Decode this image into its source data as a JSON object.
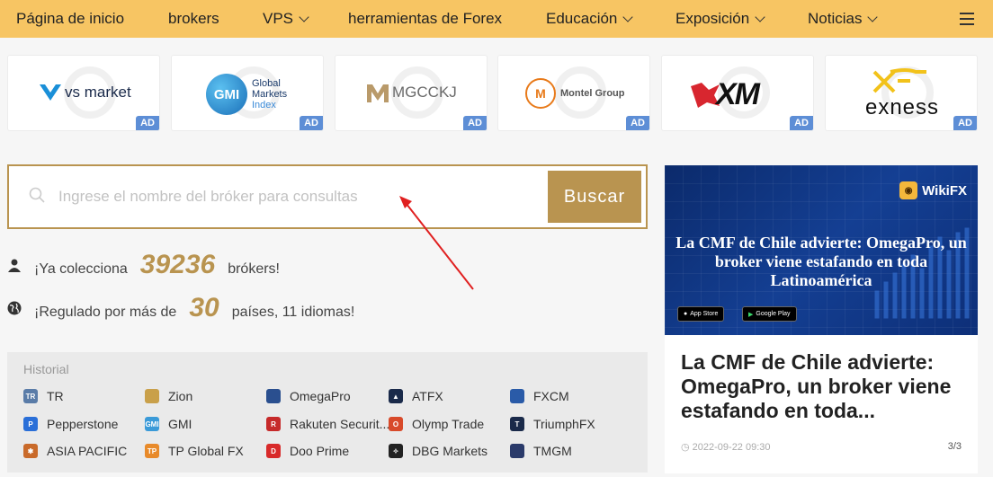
{
  "nav": {
    "items": [
      {
        "label": "Página de inicio",
        "dropdown": false
      },
      {
        "label": "brokers",
        "dropdown": false
      },
      {
        "label": "VPS",
        "dropdown": true
      },
      {
        "label": "herramientas de Forex",
        "dropdown": false
      },
      {
        "label": "Educación",
        "dropdown": true
      },
      {
        "label": "Exposición",
        "dropdown": true
      },
      {
        "label": "Noticias",
        "dropdown": true
      }
    ],
    "menu_icon": "hamburger-icon"
  },
  "ads": {
    "badge": "AD",
    "items": [
      {
        "name": "vs market"
      },
      {
        "name": "Global Markets Index",
        "line1": "Global",
        "line2": "Markets",
        "line3": "Index",
        "mark": "GMI"
      },
      {
        "name": "MGCCKJ"
      },
      {
        "name": "Montel Group"
      },
      {
        "name": "XM"
      },
      {
        "name": "exness"
      }
    ]
  },
  "search": {
    "placeholder": "Ingrese el nombre del bróker para consultas",
    "button": "Buscar"
  },
  "stats": {
    "collect_prefix": "¡Ya colecciona",
    "collect_count": "39236",
    "collect_suffix": "brókers!",
    "reg_prefix": "¡Regulado por más de",
    "reg_count": "30",
    "reg_suffix": "países, 11 idiomas!"
  },
  "history": {
    "title": "Historial",
    "items": [
      {
        "label": "TR",
        "color": "#5a7ca8"
      },
      {
        "label": "Zion",
        "color": "#c9a04a"
      },
      {
        "label": "OmegaPro",
        "color": "#2a4f8f"
      },
      {
        "label": "ATFX",
        "color": "#1a2a4a"
      },
      {
        "label": "FXCM",
        "color": "#2a5ba8"
      },
      {
        "label": "Pepperstone",
        "color": "#2a6fd8"
      },
      {
        "label": "GMI",
        "color": "#3a9ad8"
      },
      {
        "label": "Rakuten Securit...",
        "color": "#c62a2a"
      },
      {
        "label": "Olymp Trade",
        "color": "#d84a2a"
      },
      {
        "label": "TriumphFX",
        "color": "#1a2a4a"
      },
      {
        "label": "ASIA PACIFIC",
        "color": "#c96a2a"
      },
      {
        "label": "TP Global FX",
        "color": "#e88a2a"
      },
      {
        "label": "Doo Prime",
        "color": "#d82a2a"
      },
      {
        "label": "DBG Markets",
        "color": "#222222"
      },
      {
        "label": "TMGM",
        "color": "#2a3a6a"
      }
    ]
  },
  "news": {
    "brand": "WikiFX",
    "image_title": "La CMF de Chile advierte: OmegaPro, un broker viene estafando en toda Latinoamérica",
    "app_store": "App Store",
    "google_play": "Google Play",
    "title": "La CMF de Chile advierte: OmegaPro, un broker viene estafando en toda...",
    "date": "2022-09-22 09:30",
    "page": "3/3"
  },
  "colors": {
    "nav_bg": "#f7c563",
    "accent": "#b99450",
    "ad_badge": "#5d8ed6"
  }
}
